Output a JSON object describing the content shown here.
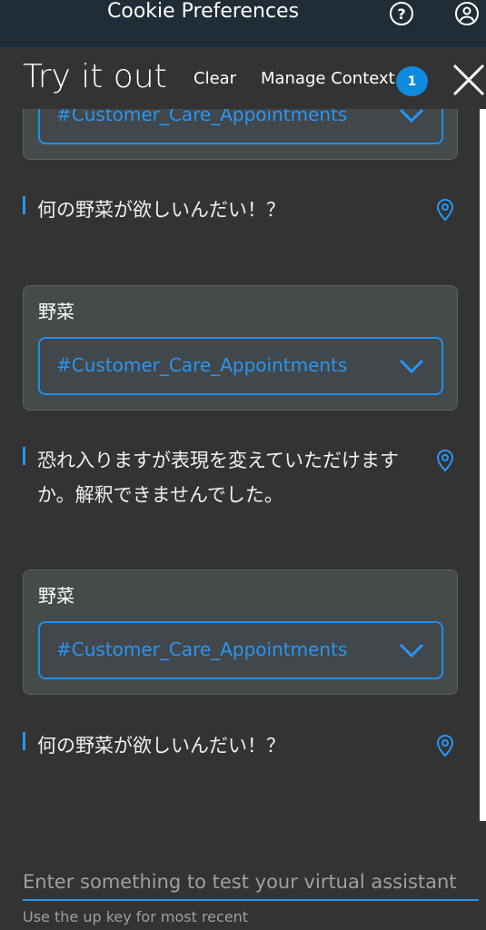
{
  "topbar": {
    "title": "Cookie Preferences",
    "help_icon": "question-circle-icon",
    "user_icon": "user-avatar-icon"
  },
  "panel": {
    "heading": "Try it out",
    "clear_label": "Clear",
    "manage_context_label": "Manage Context",
    "context_count": "1",
    "close_icon": "close-icon"
  },
  "conversation": {
    "cards": [
      {
        "label": "野菜",
        "intent": "#Customer_Care_Appointments"
      },
      {
        "label": "野菜",
        "intent": "#Customer_Care_Appointments"
      },
      {
        "label": "野菜",
        "intent": "#Customer_Care_Appointments"
      }
    ],
    "messages": [
      {
        "text": "何の野菜が欲しいんだい！？"
      },
      {
        "text": "恐れ入りますが表現を変えていただけますか。解釈できませんでした。"
      },
      {
        "text": "何の野菜が欲しいんだい！？"
      }
    ]
  },
  "composer": {
    "placeholder": "Enter something to test your virtual assistant",
    "hint": "Use the up key for most recent"
  },
  "colors": {
    "accent": "#0f8be0",
    "link": "#2a96f5",
    "background": "#333333",
    "topbar": "#202c36",
    "card": "#454b4b"
  }
}
